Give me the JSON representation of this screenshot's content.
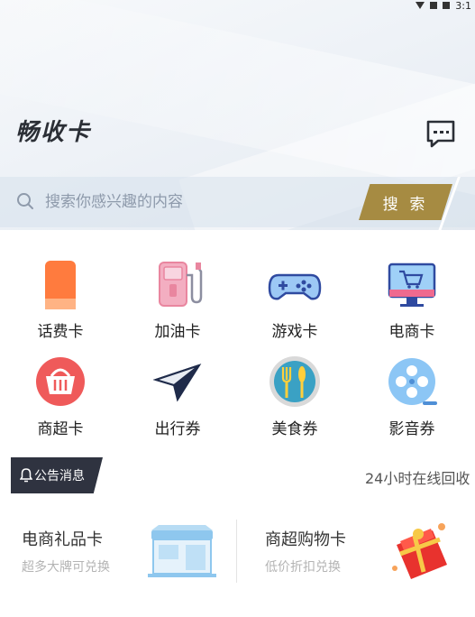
{
  "status_bar": {
    "time": "3:1"
  },
  "header": {
    "title": "畅收卡"
  },
  "search": {
    "placeholder": "搜索你感兴趣的内容",
    "button_label": "搜 索"
  },
  "categories": [
    {
      "label": "话费卡",
      "icon": "phone-card-icon"
    },
    {
      "label": "加油卡",
      "icon": "fuel-pump-icon"
    },
    {
      "label": "游戏卡",
      "icon": "gamepad-icon"
    },
    {
      "label": "电商卡",
      "icon": "shopping-cart-monitor-icon"
    },
    {
      "label": "商超卡",
      "icon": "shopping-basket-icon"
    },
    {
      "label": "出行券",
      "icon": "paper-plane-icon"
    },
    {
      "label": "美食券",
      "icon": "fork-knife-icon"
    },
    {
      "label": "影音券",
      "icon": "film-reel-icon"
    }
  ],
  "notice": {
    "tag": "公告消息",
    "text": "24小时在线回收"
  },
  "promo_cards": [
    {
      "title": "电商礼品卡",
      "subtitle": "超多大牌可兑换",
      "image": "storefront-illustration"
    },
    {
      "title": "商超购物卡",
      "subtitle": "低价折扣兑换",
      "image": "red-gift-box-illustration"
    }
  ],
  "colors": {
    "accent_gold": "#a68b42",
    "notice_bg": "#2f3340",
    "header_bg": "#e9eef4"
  }
}
